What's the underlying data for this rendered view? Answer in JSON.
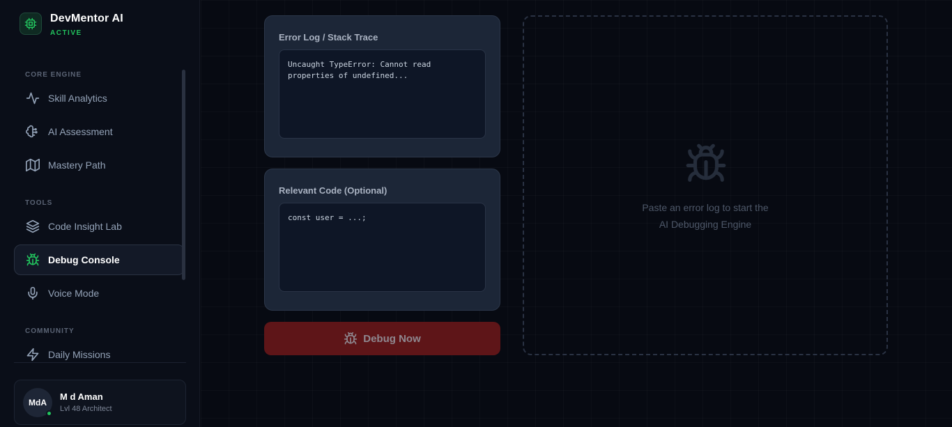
{
  "brand": {
    "title": "DevMentor AI",
    "status": "ACTIVE"
  },
  "sidebar": {
    "sections": [
      {
        "label": "CORE ENGINE"
      },
      {
        "label": "TOOLS"
      },
      {
        "label": "COMMUNITY"
      }
    ],
    "items": [
      {
        "label": "Skill Analytics",
        "icon": "activity-icon"
      },
      {
        "label": "AI Assessment",
        "icon": "brain-icon"
      },
      {
        "label": "Mastery Path",
        "icon": "map-icon"
      },
      {
        "label": "Code Insight Lab",
        "icon": "layers-icon"
      },
      {
        "label": "Debug Console",
        "icon": "bug-icon",
        "active": true
      },
      {
        "label": "Voice Mode",
        "icon": "microphone-icon"
      },
      {
        "label": "Daily Missions",
        "icon": "zap-icon"
      }
    ]
  },
  "user": {
    "initials": "MdA",
    "name": "M d Aman",
    "level": "Lvl 48 Architect",
    "online": true
  },
  "main": {
    "error_panel": {
      "label": "Error Log / Stack Trace",
      "value": "Uncaught TypeError: Cannot read\nproperties of undefined..."
    },
    "code_panel": {
      "label": "Relevant Code (Optional)",
      "value": "const user = ...;"
    },
    "debug_button": {
      "label": "Debug Now"
    },
    "result": {
      "line1": "Paste an error log to start the",
      "line2": "AI Debugging Engine"
    }
  },
  "colors": {
    "accent": "#22c55e",
    "button": "#5e1518",
    "panel": "#1c2637",
    "background": "#070a12"
  }
}
